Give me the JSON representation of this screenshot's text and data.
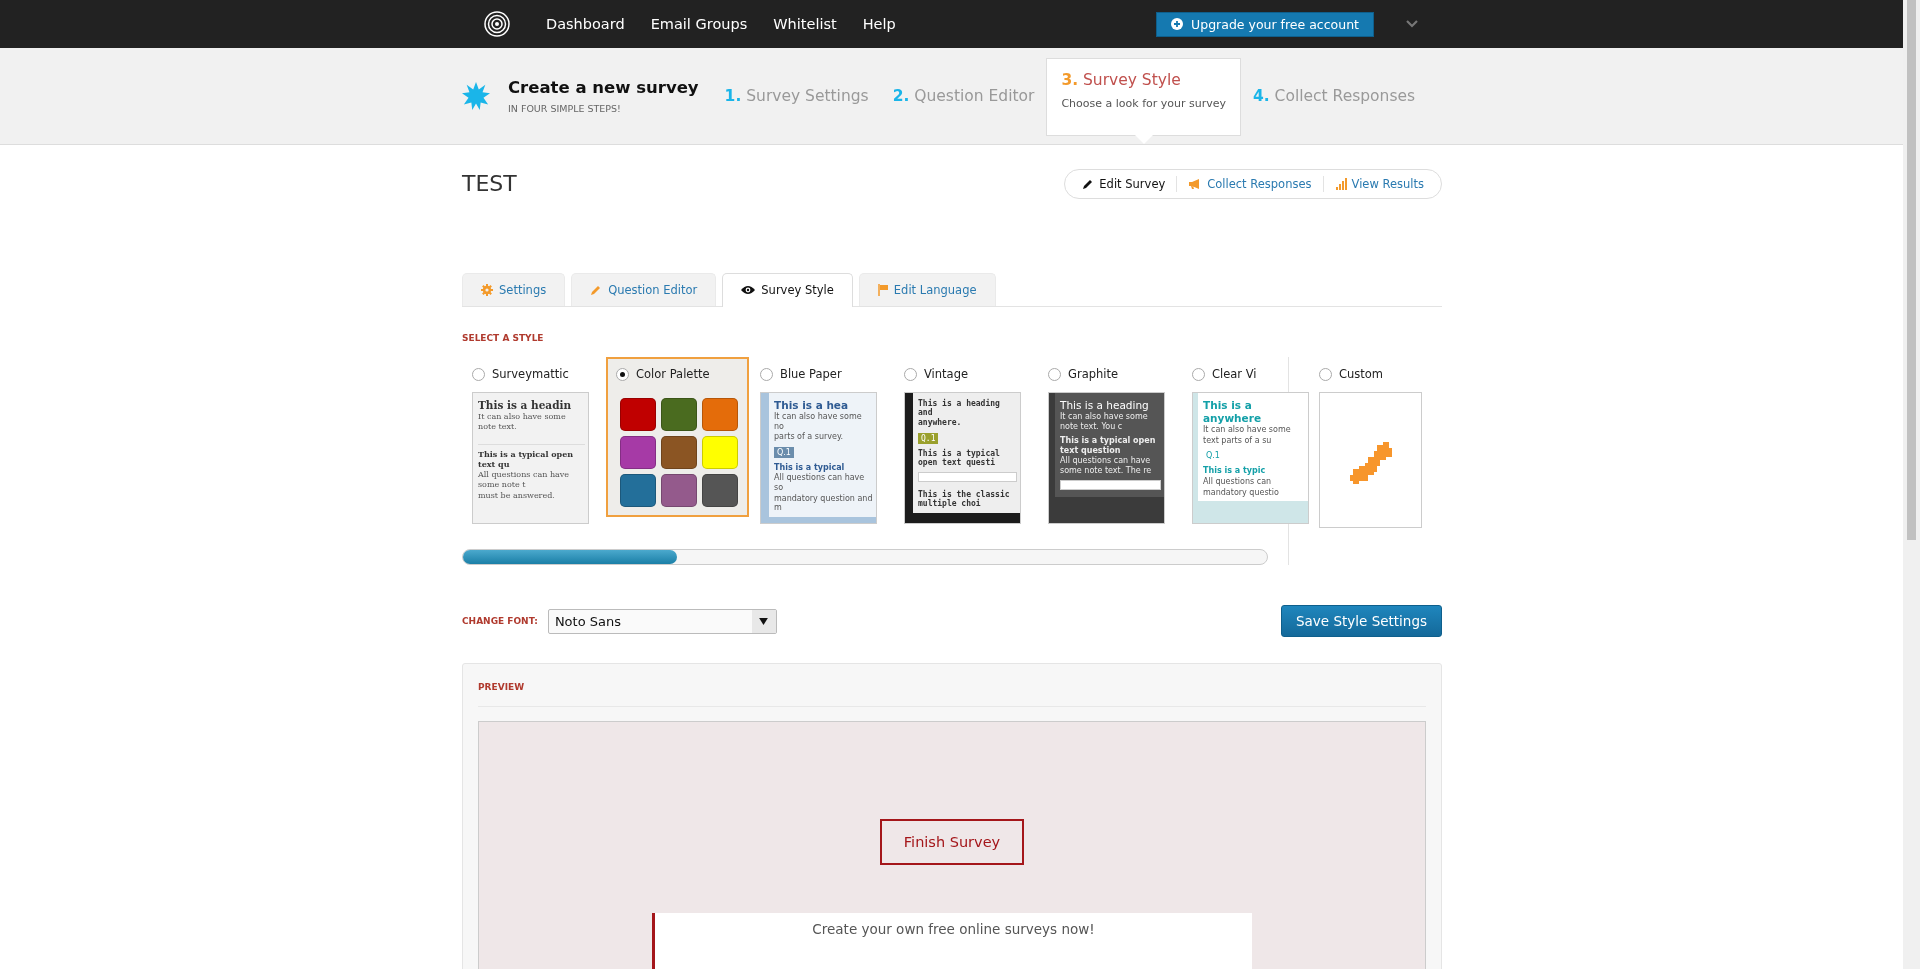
{
  "nav": {
    "items": [
      "Dashboard",
      "Email Groups",
      "Whitelist",
      "Help"
    ],
    "upgrade": "Upgrade your free account"
  },
  "wizard": {
    "title": "Create a new survey",
    "subtitle": "IN FOUR SIMPLE STEPS!",
    "steps": [
      {
        "number": "1.",
        "label": "Survey Settings",
        "selected": false
      },
      {
        "number": "2.",
        "label": "Question Editor",
        "selected": false
      },
      {
        "number": "3.",
        "label": "Survey Style",
        "hint": "Choose a look for your survey",
        "selected": true
      },
      {
        "number": "4.",
        "label": "Collect Responses",
        "selected": false
      }
    ]
  },
  "survey": {
    "title": "TEST",
    "actions": [
      "Edit Survey",
      "Collect Responses",
      "View Results"
    ]
  },
  "tabs": [
    {
      "label": "Settings",
      "selected": false
    },
    {
      "label": "Question Editor",
      "selected": false
    },
    {
      "label": "Survey Style",
      "selected": true
    },
    {
      "label": "Edit Language",
      "selected": false
    }
  ],
  "styles": {
    "heading": "SELECT A STYLE",
    "items": [
      {
        "name": "Surveymattic",
        "selected": false,
        "kind": "plain",
        "lines": [
          {
            "kind": "heading",
            "text": "This is a headin"
          },
          {
            "kind": "note",
            "text": "It can also have some note text."
          },
          {
            "kind": "gap"
          },
          {
            "kind": "question",
            "text": "This is a typical open text qu"
          },
          {
            "kind": "note",
            "text": "All questions can have some note t"
          },
          {
            "kind": "note",
            "text": "must be answered."
          }
        ]
      },
      {
        "name": "Color Palette",
        "selected": true,
        "kind": "palette",
        "swatches": [
          {
            "color": "#c00000"
          },
          {
            "color": "#4a6b1f"
          },
          {
            "color": "#e46c0a"
          },
          {
            "color": "#a63aa6"
          },
          {
            "color": "#8b5523"
          },
          {
            "color": "#ffff00"
          },
          {
            "color": "#236f9a"
          },
          {
            "color": "#945a8c"
          },
          {
            "color": "#555555"
          }
        ]
      },
      {
        "name": "Blue Paper",
        "selected": false,
        "kind": "paper",
        "lines": [
          {
            "kind": "heading",
            "text": "This is a hea"
          },
          {
            "kind": "note",
            "text": "It can also have some no"
          },
          {
            "kind": "note",
            "text": "parts of a survey."
          },
          {
            "kind": "qnum",
            "text": "Q.1"
          },
          {
            "kind": "question",
            "text": "This is a typical"
          },
          {
            "kind": "note",
            "text": "All questions can have so"
          },
          {
            "kind": "note",
            "text": "mandatory question and m"
          }
        ]
      },
      {
        "name": "Vintage",
        "selected": false,
        "kind": "vintage",
        "lines": [
          {
            "kind": "heading",
            "text": "This is a heading and"
          },
          {
            "kind": "heading",
            "text": "anywhere."
          },
          {
            "kind": "qnum",
            "text": "Q.1"
          },
          {
            "kind": "question",
            "text": "This is a typical open text questi"
          },
          {
            "kind": "field"
          },
          {
            "kind": "question",
            "text": "This is the classic multiple choi"
          }
        ]
      },
      {
        "name": "Graphite",
        "selected": false,
        "kind": "graphite",
        "lines": [
          {
            "kind": "heading",
            "text": "This is a heading"
          },
          {
            "kind": "note",
            "text": "It can also have some note text. You c"
          },
          {
            "kind": "question",
            "text": "This is a typical open text question"
          },
          {
            "kind": "note",
            "text": "All questions can have some note text. The re"
          },
          {
            "kind": "field"
          }
        ]
      },
      {
        "name": "Clear Vi",
        "selected": false,
        "kind": "clear",
        "lines": [
          {
            "kind": "heading",
            "text": "This is a"
          },
          {
            "kind": "heading",
            "text": "anywhere"
          },
          {
            "kind": "note",
            "text": "It can also have some"
          },
          {
            "kind": "note",
            "text": "text parts of a su"
          },
          {
            "kind": "qnum",
            "text": "Q.1"
          },
          {
            "kind": "question",
            "text": "This is a typic"
          },
          {
            "kind": "note",
            "text": "All questions can"
          },
          {
            "kind": "note",
            "text": "mandatory questio"
          }
        ]
      }
    ],
    "custom": {
      "name": "Custom",
      "selected": false
    }
  },
  "font": {
    "label": "CHANGE FONT:",
    "value": "Noto Sans"
  },
  "save_button": "Save Style Settings",
  "preview": {
    "heading": "PREVIEW",
    "finish_button": "Finish Survey",
    "footer_text": "Create your own free online surveys now!"
  }
}
